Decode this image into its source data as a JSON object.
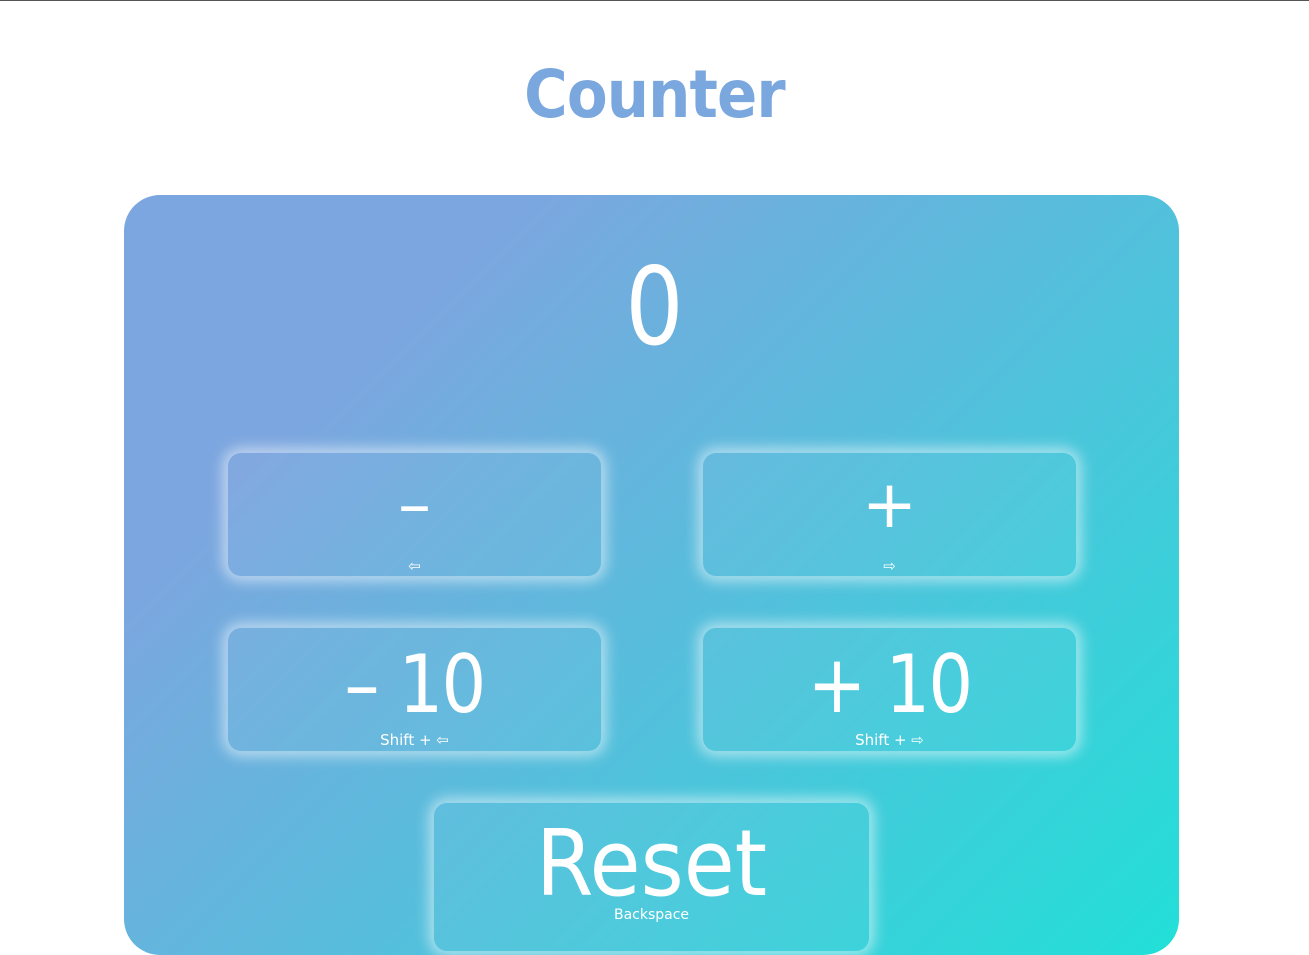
{
  "app": {
    "title": "Counter",
    "count": "0"
  },
  "buttons": {
    "decrement": {
      "label": "–",
      "hint": "⇦"
    },
    "increment": {
      "label": "+",
      "hint": "⇨"
    },
    "decrement10": {
      "label": "– 10",
      "hint": "Shift + ⇦"
    },
    "increment10": {
      "label": "+ 10",
      "hint": "Shift + ⇨"
    },
    "reset": {
      "label": "Reset",
      "hint": "Backspace"
    }
  },
  "colors": {
    "title": "#7aa7dd",
    "gradient_start": "#7ca6df",
    "gradient_end": "#22dfd8",
    "text": "#ffffff"
  }
}
